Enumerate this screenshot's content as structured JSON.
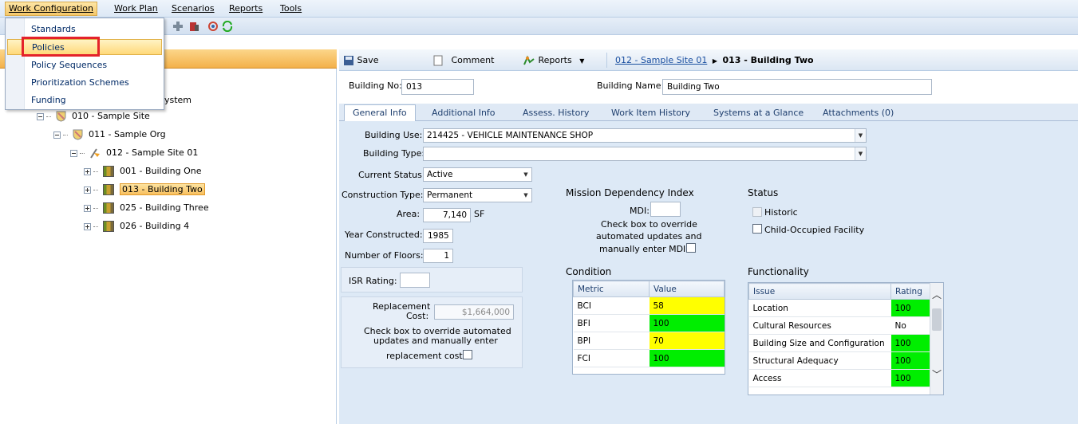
{
  "menubar": {
    "items": [
      "Work Configuration",
      "Work Plan",
      "Scenarios",
      "Reports",
      "Tools"
    ]
  },
  "dropdown": {
    "items": [
      "Standards",
      "Policies",
      "Policy Sequences",
      "Prioritization Schemes",
      "Funding"
    ],
    "highlighted": "Policies"
  },
  "tree": {
    "partial_label": "System",
    "items": [
      {
        "label": "010 - Sample Site"
      },
      {
        "label": "011 - Sample Org"
      },
      {
        "label": "012 - Sample Site 01"
      },
      {
        "label": "001 - Building One"
      },
      {
        "label": "013 - Building Two",
        "selected": true
      },
      {
        "label": "025 - Building Three"
      },
      {
        "label": "026 - Building 4"
      }
    ]
  },
  "right_toolbar": {
    "save": "Save",
    "comment": "Comment",
    "reports": "Reports",
    "breadcrumb_link": "012 - Sample Site 01",
    "breadcrumb_current": "013 - Building Two"
  },
  "header_fields": {
    "building_no_label": "Building No:",
    "building_no": "013",
    "building_name_label": "Building Name:",
    "building_name": "Building Two"
  },
  "tabs": [
    "General Info",
    "Additional Info",
    "Assess. History",
    "Work Item History",
    "Systems at a Glance",
    "Attachments (0)"
  ],
  "general": {
    "building_use_label": "Building Use:",
    "building_use": "214425 - VEHICLE MAINTENANCE SHOP",
    "building_type_label": "Building Type:",
    "building_type": "",
    "current_status_label": "Current Status:",
    "current_status": "Active",
    "construction_type_label": "Construction Type:",
    "construction_type": "Permanent",
    "area_label": "Area:",
    "area": "7,140",
    "area_unit": "SF",
    "year_label": "Year Constructed:",
    "year": "1985",
    "floors_label": "Number of Floors:",
    "floors": "1",
    "isr_label": "ISR Rating:",
    "isr": "",
    "replacement_label_1": "Replacement",
    "replacement_label_2": "Cost:",
    "replacement_cost": "$1,664,000",
    "replacement_note_1": "Check box to override automated",
    "replacement_note_2": "updates and manually enter",
    "replacement_note_3": "replacement cost:"
  },
  "mdi": {
    "title": "Mission Dependency Index",
    "label": "MDI:",
    "value": "",
    "note_1": "Check box to override",
    "note_2": "automated updates and",
    "note_3": "manually enter MDI:"
  },
  "status": {
    "title": "Status",
    "historic": "Historic",
    "child": "Child-Occupied Facility"
  },
  "condition": {
    "title": "Condition",
    "col_metric": "Metric",
    "col_value": "Value",
    "rows": [
      {
        "metric": "BCI",
        "value": "58",
        "color": "#ffff00"
      },
      {
        "metric": "BFI",
        "value": "100",
        "color": "#00ee00"
      },
      {
        "metric": "BPI",
        "value": "70",
        "color": "#ffff00"
      },
      {
        "metric": "FCI",
        "value": "100",
        "color": "#00ee00"
      }
    ]
  },
  "functionality": {
    "title": "Functionality",
    "col_issue": "Issue",
    "col_rating": "Rating",
    "rows": [
      {
        "issue": "Location",
        "rating": "100",
        "color": "#00ee00"
      },
      {
        "issue": "Cultural Resources",
        "rating": "No",
        "color": "#ffffff"
      },
      {
        "issue": "Building Size and Configuration",
        "rating": "100",
        "color": "#00ee00"
      },
      {
        "issue": "Structural Adequacy",
        "rating": "100",
        "color": "#00ee00"
      },
      {
        "issue": "Access",
        "rating": "100",
        "color": "#00ee00"
      }
    ]
  }
}
